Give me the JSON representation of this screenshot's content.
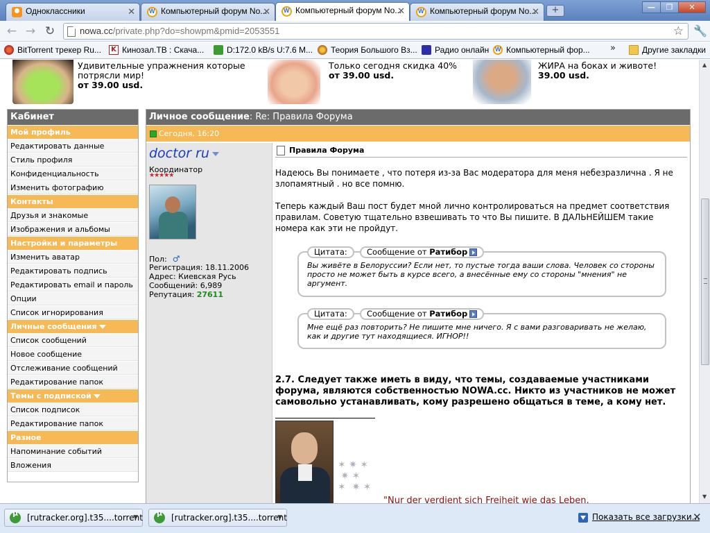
{
  "tabs": [
    {
      "title": "Одноклассники",
      "icon": "odnoklassniki-icon",
      "active": false
    },
    {
      "title": "Компьютерный форум No...",
      "icon": "forum-icon",
      "active": false
    },
    {
      "title": "Компьютерный форум No...",
      "icon": "forum-icon",
      "active": true
    },
    {
      "title": "Компьютерный форум No...",
      "icon": "forum-icon",
      "active": false
    }
  ],
  "window": {
    "minimize": "—",
    "maximize": "❐",
    "close": "✕"
  },
  "address": {
    "host": "nowa.cc",
    "path": "/private.php?do=showpm&pmid=2053551"
  },
  "bookmarks": [
    {
      "label": "BitTorrent трекер Ru...",
      "icon": "bittorrent-icon"
    },
    {
      "label": "Кинозал.ТВ : Скача...",
      "icon": "kinozal-icon"
    },
    {
      "label": "D:172.0 kB/s U:7.6 M...",
      "icon": "utorrent-icon"
    },
    {
      "label": "Теория Большого Вз...",
      "icon": "tbbt-icon"
    },
    {
      "label": "Радио онлайн",
      "icon": "radio-icon"
    },
    {
      "label": "Компьютерный фор...",
      "icon": "forum-icon"
    }
  ],
  "bookmarks_other": "Другие закладки",
  "ads": [
    {
      "line1": "Удивительные упражнения которые",
      "line2": "потрясли мир!",
      "price": "от 39.00 usd."
    },
    {
      "line1": "Только сегодня скидка 40%",
      "line2": "",
      "price": "от 39.00 usd."
    },
    {
      "line1": "ЖИРА на боках и животе!",
      "line2": "",
      "price": "39.00 usd."
    }
  ],
  "sidebar": {
    "title": "Кабинет",
    "sections": [
      {
        "title": "Мой профиль",
        "items": [
          "Редактировать данные",
          "Стиль профиля",
          "Конфиденциальность",
          "Изменить фотографию"
        ]
      },
      {
        "title": "Контакты",
        "items": [
          "Друзья и знакомые",
          "Изображения и альбомы"
        ]
      },
      {
        "title": "Настройки и параметры",
        "items": [
          "Изменить аватар",
          "Редактировать подпись",
          "Редактировать email и пароль",
          "Опции",
          "Список игнорирования"
        ]
      },
      {
        "title": "Личные сообщения",
        "items": [
          "Список сообщений",
          "Новое сообщение",
          "Отслеживание сообщений",
          "Редактирование папок"
        ]
      },
      {
        "title": "Темы с подпиской",
        "items": [
          "Список подписок",
          "Редактирование папок"
        ]
      },
      {
        "title": "Разное",
        "items": [
          "Напоминание событий",
          "Вложения"
        ]
      }
    ]
  },
  "message": {
    "header_label": "Личное сообщение",
    "header_subject": ": Re: Правила Форума",
    "date": "Сегодня, 16:20",
    "author": {
      "name": "doctor ru",
      "rank": "Координатор",
      "stars": "★★★★★",
      "gender_label": "Пол:",
      "gender_symbol": "♂",
      "registration": "Регистрация: 18.11.2006",
      "address": "Адрес: Киевская Русь",
      "posts": "Сообщений: 6,989",
      "reputation_label": "Репутация:",
      "reputation_value": "27611"
    },
    "title": "Правила Форума",
    "paragraph1": "Надеюсь Вы понимаете , что потеря из-за Вас модератора для меня небезразлична . Я не злопамятный . но все помню.",
    "paragraph2": "Теперь каждый Ваш пост будет мной лично контролироваться на предмет соответствия правилам. Советую тщательно взвешивать то что Вы пишите. В ДАЛЬНЕЙШЕМ такие номера как эти не пройдут.",
    "quotes": [
      {
        "label": "Цитата:",
        "from_prefix": "Сообщение от",
        "from_name": "Ратибор",
        "text": "Вы живёте в Белоруссии? Если нет, то пустые тогда ваши слова. Человек со стороны просто не может быть в курсе всего, а внесённые ему со стороны \"мнения\" не аргумент."
      },
      {
        "label": "Цитата:",
        "from_prefix": "Сообщение от",
        "from_name": "Ратибор",
        "text": "Мне ещё раз повторить? Не пишите мне ничего. Я с вами разговаривать не желаю, как и другие тут находящиеся. ИГНОР!!"
      }
    ],
    "rule_text": "2.7. Следует также иметь в виду, что темы, создаваемые участниками форума, являются собственностью NOWA.cc. Никто из участников не может самовольно устанавливать, кому разрешено общаться в теме, а кому нет.",
    "signature_quote": "\"Nur der verdient sich Freiheit wie das Leben,"
  },
  "downloads": {
    "items": [
      "[rutracker.org].t35....torrent",
      "[rutracker.org].t35....torrent"
    ],
    "show_all": "Показать все загрузки...",
    "close": "✕"
  }
}
